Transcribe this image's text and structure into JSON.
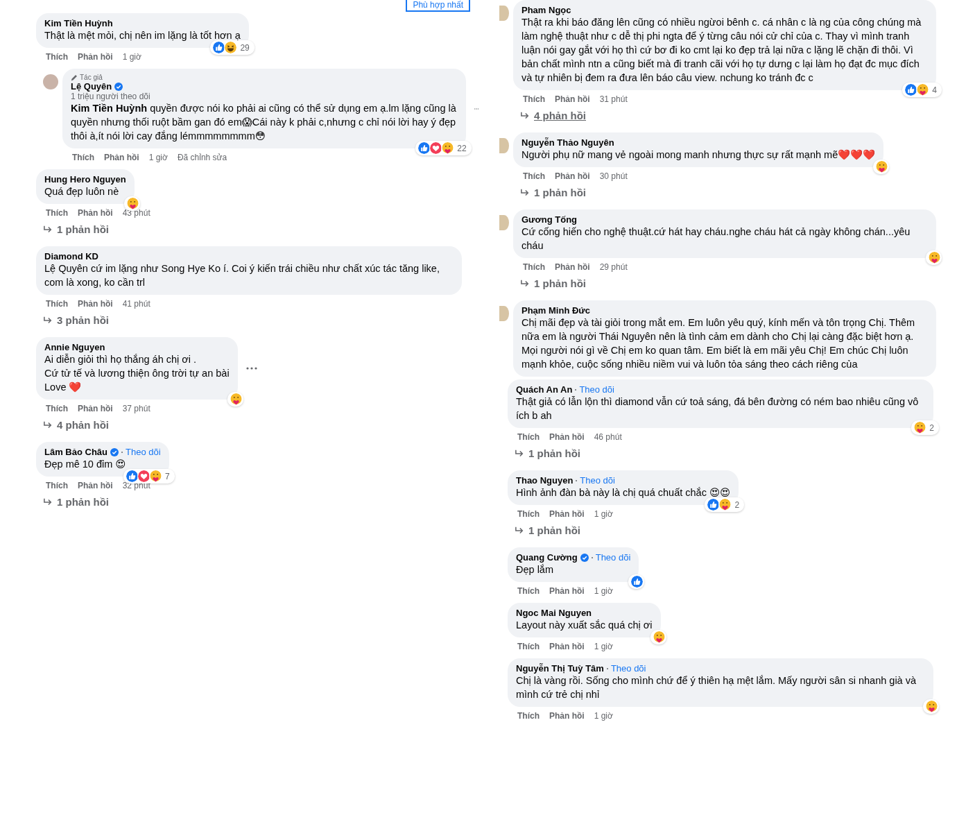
{
  "sort_button": "Phù hợp nhất",
  "columns": [
    {
      "comments": [
        {
          "name": "Kim Tiền Huỳnh",
          "text": "Thật là mệt mỏi, chị nên im lặng là tốt hơn ạ",
          "reactions": [
            {
              "kind": "like"
            },
            {
              "kind": "haha"
            }
          ],
          "reaction_count": "29",
          "actions": [
            "Thích",
            "Phản hồi"
          ],
          "time": "1 giờ",
          "children": [
            {
              "name": "Lệ Quyên",
              "badge": "Tác giả",
              "verified": true,
              "avatar": true,
              "more": true,
              "subtitle": "1 triệu người theo dõi",
              "text": "**Kim Tiền Huỳnh** quyền được nói ko phải ai cũng có thể sử dụng em ạ.lm lặng cũng là quyền nhưng thối ruột bầm gan đó em😱Cái này k phải c,nhưng c chỉ nói lời hay ý đẹp thôi à,ít nói lời cay đắng lémmmmmmmm😳",
              "reactions": [
                {
                  "kind": "like"
                },
                {
                  "kind": "love"
                },
                {
                  "kind": "care"
                }
              ],
              "reaction_count": "22",
              "actions": [
                "Thích",
                "Phản hồi"
              ],
              "time": "1 giờ",
              "edited": "Đã chỉnh sửa"
            }
          ]
        },
        {
          "name": "Hung Hero Nguyen",
          "text": "Quá đẹp luôn nè",
          "reactions": [
            {
              "kind": "care"
            }
          ],
          "actions": [
            "Thích",
            "Phản hồi"
          ],
          "time": "43 phút",
          "replies": "1 phản hồi"
        },
        {
          "name": "Diamond KD",
          "text": "Lệ Quyên cứ im lặng như Song Hye Ko í. Coi ý kiến trái chiều như chất xúc tác tăng like, com là xong, ko cần trl",
          "actions": [
            "Thích",
            "Phản hồi"
          ],
          "time": "41 phút",
          "replies": "3 phản hồi"
        },
        {
          "name": "Annie Nguyen",
          "more": true,
          "text": "Ai diễn giỏi thì họ thắng áh chị ơi .\nCứ tử tế và lương thiện ông trời tự an bài\nLove ❤️",
          "reactions": [
            {
              "kind": "care"
            }
          ],
          "actions": [
            "Thích",
            "Phản hồi"
          ],
          "time": "37 phút",
          "replies": "4 phản hồi"
        },
        {
          "name": "Lâm Bảo Châu",
          "verified": true,
          "follow": "Theo dõi",
          "text": "Đẹp mê 10 đỉm 😍",
          "reactions": [
            {
              "kind": "like"
            },
            {
              "kind": "love"
            },
            {
              "kind": "care"
            }
          ],
          "reaction_count": "7",
          "actions": [
            "Thích",
            "Phản hồi"
          ],
          "time": "32 phút",
          "replies": "1 phản hồi"
        }
      ]
    },
    {
      "comments": [
        {
          "name": "Pham Ngọc",
          "avatar": true,
          "text": "Thật ra khi báo đăng lên cũng có nhiều ngừoi bênh c. cá nhân c là ng của công chúng mà làm nghệ thuật như c dễ thị phi ngta để ý từng câu nói cử chỉ của c. Thay vì mình tranh luận nói gay gắt với họ thì cứ bơ đi ko cmt lại ko đẹp trả lại nữa c lặng lẽ chặn đi thôi. Vì bản chất mình ntn a cũng biết mà đi tranh cãi với họ tự dưng c lại làm họ đạt đc mục đích và tự nhiên bị đem ra đưa lên báo câu view. nchung ko tránh đc c",
          "reactions": [
            {
              "kind": "like"
            },
            {
              "kind": "care"
            }
          ],
          "reaction_count": "4",
          "actions": [
            "Thích",
            "Phản hồi"
          ],
          "time": "31 phút",
          "replies": "4 phản hồi",
          "replies_underlined": true
        },
        {
          "name": "Nguyễn Thảo Nguyên",
          "avatar": true,
          "text": "Người phụ nữ mang vẻ ngoài mong manh nhưng thực sự rất mạnh mẽ❤️❤️❤️",
          "reactions": [
            {
              "kind": "care"
            }
          ],
          "actions": [
            "Thích",
            "Phản hồi"
          ],
          "time": "30 phút",
          "replies": "1 phản hồi",
          "replies_underlined": false
        },
        {
          "name": "Gương Tống",
          "avatar": true,
          "text": "Cứ cống hiến cho nghệ thuật.cứ hát hay cháu.nghe cháu hát cả ngày không chán...yêu cháu",
          "reactions": [
            {
              "kind": "care"
            }
          ],
          "actions": [
            "Thích",
            "Phản hồi"
          ],
          "time": "29 phút",
          "replies": "1 phản hồi",
          "replies_underlined": false
        },
        {
          "name": "Phạm Minh Đức",
          "avatar": true,
          "text": "Chị mãi đẹp và tài giỏi trong mắt em. Em luôn yêu quý, kính mến và tôn trọng Chị. Thêm nữa em là người Thái Nguyên nên là tình cảm em dành cho Chị lại càng đặc biệt hơn ạ. Mọi người nói gì về Chị em ko quan tâm. Em biết là em mãi yêu Chị! Em chúc Chị luôn mạnh khỏe, cuộc sống nhiều niềm vui và luôn tỏa sáng theo cách riêng của"
        },
        {
          "name": "Quách An An",
          "follow": "Theo dõi",
          "text": "Thật giả có lẫn lộn thì diamond vẫn cứ toả sáng, đá bên đường có ném bao nhiêu cũng vô ích b ah",
          "reactions": [
            {
              "kind": "care"
            }
          ],
          "reaction_count": "2",
          "actions": [
            "Thích",
            "Phản hồi"
          ],
          "time": "46 phút",
          "replies": "1 phản hồi",
          "replies_underlined": false
        },
        {
          "name": "Thao Nguyen",
          "follow": "Theo dõi",
          "text": "Hình ảnh đàn bà này là chị quá chuất chắc 😍😍",
          "reactions": [
            {
              "kind": "like"
            },
            {
              "kind": "care"
            }
          ],
          "reaction_count": "2",
          "actions": [
            "Thích",
            "Phản hồi"
          ],
          "time": "1 giờ",
          "replies": "1 phản hồi",
          "replies_underlined": false
        },
        {
          "name": "Quang Cường",
          "verified": true,
          "follow": "Theo dõi",
          "text": "Đẹp lắm",
          "reactions": [
            {
              "kind": "like"
            }
          ],
          "actions": [
            "Thích",
            "Phản hồi"
          ],
          "time": "1 giờ"
        },
        {
          "name": "Ngoc Mai Nguyen",
          "text": "Layout này xuất sắc quá chị ơi",
          "reactions": [
            {
              "kind": "care"
            }
          ],
          "actions": [
            "Thích",
            "Phản hồi"
          ],
          "time": "1 giờ"
        },
        {
          "name": "Nguyễn Thị Tuỳ Tâm",
          "follow": "Theo dõi",
          "text": "Chị là vàng rồi. Sống cho mình chứ để ý thiên hạ mệt lắm. Mấy người sân si nhanh già và mình cứ trẻ chị nhỉ",
          "reactions": [
            {
              "kind": "care"
            }
          ],
          "actions": [
            "Thích",
            "Phản hồi"
          ],
          "time": "1 giờ"
        }
      ]
    }
  ]
}
